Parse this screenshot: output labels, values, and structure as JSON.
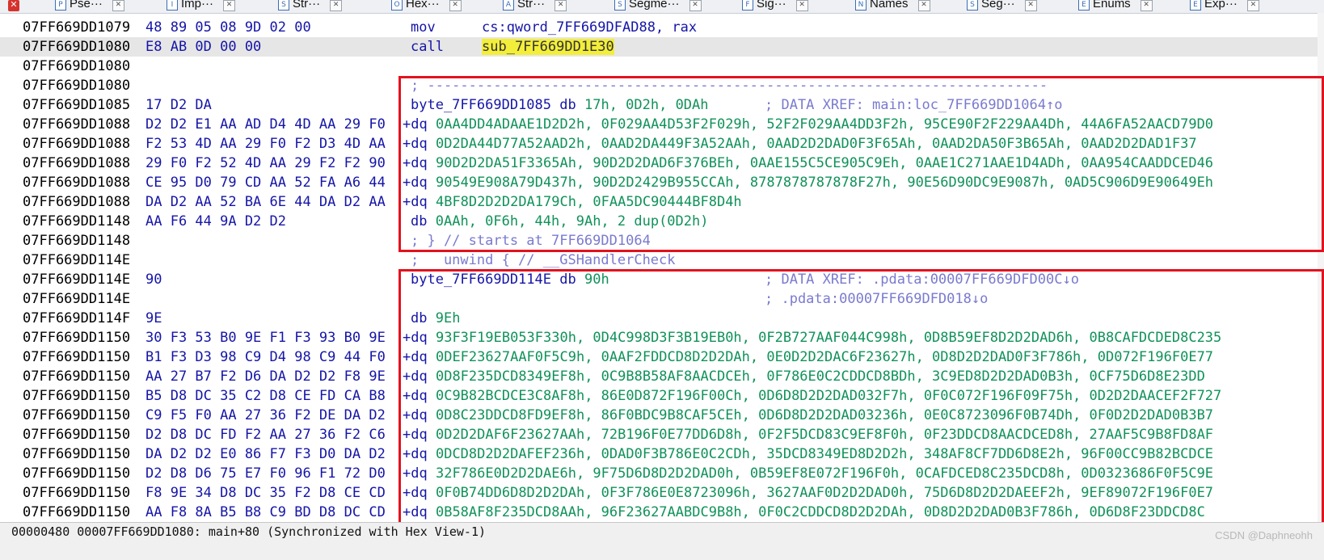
{
  "tabs": [
    {
      "label": "Pse···",
      "icon": "P"
    },
    {
      "label": "Imp···",
      "icon": "I"
    },
    {
      "label": "Str···",
      "icon": "S"
    },
    {
      "label": "Hex···",
      "icon": "O"
    },
    {
      "label": "Str···",
      "icon": "A"
    },
    {
      "label": "Segme···",
      "icon": "S"
    },
    {
      "label": "Sig···",
      "icon": "F"
    },
    {
      "label": "Names",
      "icon": "N"
    },
    {
      "label": "Seg···",
      "icon": "S"
    },
    {
      "label": "Enums",
      "icon": "E"
    },
    {
      "label": "Exp···",
      "icon": "E"
    }
  ],
  "rows": [
    {
      "addr": "07FF669DD1079",
      "bytes": "48 89 05 08 9D 02 00",
      "mnem": "mov",
      "oper": "cs:qword_7FF669DFAD88, rax"
    },
    {
      "addr": "07FF669DD1080",
      "bytes": "E8 AB 0D 00 00",
      "mnem": "call",
      "oper_hl": "sub_7FF669DD1E30",
      "selected": true
    },
    {
      "addr": "07FF669DD1080"
    },
    {
      "addr": "07FF669DD1080",
      "comment": "; ---------------------------------------------------------------------------"
    },
    {
      "addr": "07FF669DD1085",
      "bytes": "17 D2 DA",
      "label": "byte_7FF669DD1085",
      "kw": "db",
      "num": "17h, 0D2h, 0DAh",
      "xref": "; DATA XREF: main:loc_7FF669DD1064↑o"
    },
    {
      "addr": "07FF669DD1088",
      "bytes": "D2 D2 E1 AA AD D4 4D AA 29 F0",
      "kw": "+dq",
      "vals": "0AA4DD4ADAAE1D2D2h, 0F029AA4D53F2F029h, 52F2F029AA4DD3F2h, 95CE90F2F229AA4Dh, 44A6FA52AACD79D0"
    },
    {
      "addr": "07FF669DD1088",
      "bytes": "F2 53 4D AA 29 F0 F2 D3 4D AA",
      "kw": "+dq",
      "vals": "0D2DA44D77A52AAD2h, 0AAD2DA449F3A52AAh, 0AAD2D2DAD0F3F65Ah, 0AAD2DA50F3B65Ah, 0AAD2D2DAD1F37"
    },
    {
      "addr": "07FF669DD1088",
      "bytes": "29 F0 F2 52 4D AA 29 F2 F2 90",
      "kw": "+dq",
      "vals": "90D2D2DA51F3365Ah, 90D2D2DAD6F376BEh, 0AAE155C5CE905C9Eh, 0AAE1C271AAE1D4ADh, 0AA954CAADDCED46"
    },
    {
      "addr": "07FF669DD1088",
      "bytes": "CE 95 D0 79 CD AA 52 FA A6 44",
      "kw": "+dq",
      "vals": "90549E908A79D437h, 90D2D2429B955CCAh, 8787878787878F27h, 90E56D90DC9E9087h, 0AD5C906D9E90649Eh"
    },
    {
      "addr": "07FF669DD1088",
      "bytes": "DA D2 AA 52 BA 6E 44 DA D2 AA",
      "kw": "+dq",
      "vals": "4BF8D2D2D2DA179Ch, 0FAA5DC90444BF8D4h"
    },
    {
      "addr": "07FF669DD1148",
      "bytes": "AA F6 44 9A D2 D2",
      "kw": "db",
      "num": "0AAh, 0F6h, 44h, 9Ah, 2 dup(0D2h)"
    },
    {
      "addr": "07FF669DD1148",
      "comment": "; } // starts at 7FF669DD1064"
    },
    {
      "addr": "07FF669DD114E",
      "comment": ";   unwind { // __GSHandlerCheck"
    },
    {
      "addr": "07FF669DD114E",
      "bytes": "90",
      "label": "byte_7FF669DD114E",
      "kw": "db",
      "num": "90h",
      "xref": "; DATA XREF: .pdata:00007FF669DFD00C↓o"
    },
    {
      "addr": "07FF669DD114E",
      "xref": "; .pdata:00007FF669DFD018↓o"
    },
    {
      "addr": "07FF669DD114F",
      "bytes": "9E",
      "kw": "db",
      "num": "9Eh"
    },
    {
      "addr": "07FF669DD1150",
      "bytes": "30 F3 53 B0 9E F1 F3 93 B0 9E",
      "kw": "+dq",
      "vals": "93F3F19EB053F330h, 0D4C998D3F3B19EB0h, 0F2B727AAF044C998h, 0D8B59EF8D2D2DAD6h, 0B8CAFDCDED8C235"
    },
    {
      "addr": "07FF669DD1150",
      "bytes": "B1 F3 D3 98 C9 D4 98 C9 44 F0",
      "kw": "+dq",
      "vals": "0DEF23627AAF0F5C9h, 0AAF2FDDCD8D2D2DAh, 0E0D2D2DAC6F23627h, 0D8D2D2DAD0F3F786h, 0D072F196F0E77"
    },
    {
      "addr": "07FF669DD1150",
      "bytes": "AA 27 B7 F2 D6 DA D2 D2 F8 9E",
      "kw": "+dq",
      "vals": "0D8F235DCD8349EF8h, 0C9B8B58AF8AACDCEh, 0F786E0C2CDDCD8BDh, 3C9ED8D2D2DAD0B3h, 0CF75D6D8E23DD"
    },
    {
      "addr": "07FF669DD1150",
      "bytes": "B5 D8 DC 35 C2 D8 CE FD CA B8",
      "kw": "+dq",
      "vals": "0C9B82BCDCE3C8AF8h, 86E0D872F196F00Ch, 0D6D8D2D2DAD032F7h, 0F0C072F196F09F75h, 0D2D2DAACEF2F727"
    },
    {
      "addr": "07FF669DD1150",
      "bytes": "C9 F5 F0 AA 27 36 F2 DE DA D2",
      "kw": "+dq",
      "vals": "0D8C23DDCD8FD9EF8h, 86F0BDC9B8CAF5CEh, 0D6D8D2D2DAD03236h, 0E0C8723096F0B74Dh, 0F0D2D2DAD0B3B7"
    },
    {
      "addr": "07FF669DD1150",
      "bytes": "D2 D8 DC FD F2 AA 27 36 F2 C6",
      "kw": "+dq",
      "vals": "0D2D2DAF6F23627AAh, 72B196F0E77DD6D8h, 0F2F5DCD83C9EF8F0h, 0F23DDCD8AACDCED8h, 27AAF5C9B8FD8AF"
    },
    {
      "addr": "07FF669DD1150",
      "bytes": "DA D2 D2 E0 86 F7 F3 D0 DA D2",
      "kw": "+dq",
      "vals": "0DCD8D2D2DAFEF236h, 0DAD0F3B786E0C2CDh, 35DCD8349ED8D2D2h, 348AF8CF7DD6D8E2h, 96F00CC9B82BCDCE"
    },
    {
      "addr": "07FF669DD1150",
      "bytes": "D2 D8 D6 75 E7 F0 96 F1 72 D0",
      "kw": "+dq",
      "vals": "32F786E0D2D2DAE6h, 9F75D6D8D2D2DAD0h, 0B59EF8E072F196F0h, 0CAFDCED8C235DCD8h, 0D0323686F0F5C9E"
    },
    {
      "addr": "07FF669DD1150",
      "bytes": "F8 9E 34 D8 DC 35 F2 D8 CE CD",
      "kw": "+dq",
      "vals": "0F0B74DD6D8D2D2DAh, 0F3F786E0E8723096h, 3627AAF0D2D2DAD0h, 75D6D8D2D2DAEEF2h, 9EF89072F196F0E7"
    },
    {
      "addr": "07FF669DD1150",
      "bytes": "AA F8 8A B5 B8 C9 BD D8 DC CD",
      "kw": "+dq",
      "vals": "0B58AF8F235DCD8AAh, 96F23627AABDC9B8h, 0F0C2CDDCD8D2D2DAh, 0D8D2D2DAD0B3F786h, 0D6D8F23DDCD8C"
    }
  ],
  "status": {
    "text": "00000480 00007FF669DD1080: main+80 (Synchronized with Hex View-1)"
  },
  "watermark": "CSDN @Daphneohh"
}
